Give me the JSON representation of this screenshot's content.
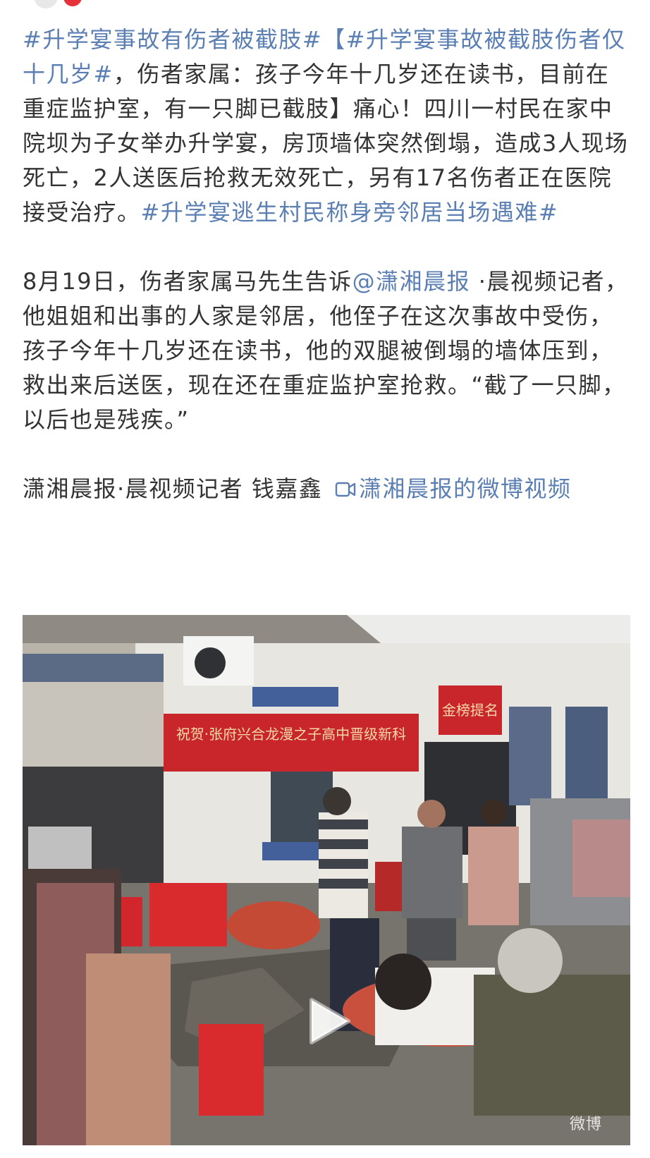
{
  "post": {
    "p1": {
      "tag1": "#升学宴事故有伤者被截肢#",
      "tag2": "【#升学宴事故被截肢伤者仅十几岁#",
      "text1": "，伤者家属：孩子今年十几岁还在读书，目前在重症监护室，有一只脚已截肢】痛心！四川一村民在家中院坝为子女举办升学宴，房顶墙体突然倒塌，造成3人现场死亡，2人送医后抢救无效死亡，另有17名伤者正在医院接受治疗。",
      "tag3": "#升学宴逃生村民称身旁邻居当场遇难#"
    },
    "p2": {
      "text1": "8月19日，伤者家属马先生告诉",
      "mention": "@潇湘晨报",
      "text2": " ·晨视频记者，他姐姐和出事的人家是邻居，他侄子在这次事故中受伤，孩子今年十几岁还在读书，他的双腿被倒塌的墙体压到，救出来后送医，现在还在重症监护室抢救。“截了一只脚，以后也是残疾。”"
    },
    "p3": {
      "credit": "潇湘晨报·晨视频记者 钱嘉鑫 ",
      "video_link": "潇湘晨报的微博视频"
    }
  },
  "video": {
    "banner_text": "祝贺·张府兴合龙漫之子高中晋级新科",
    "sign_text": "金榜提名",
    "watermark": "微博"
  },
  "colors": {
    "link": "#5b7fb3",
    "text": "#333333",
    "banner": "#c8262a"
  },
  "icons": {
    "video_link": "video-camera-icon",
    "play": "play-icon"
  }
}
